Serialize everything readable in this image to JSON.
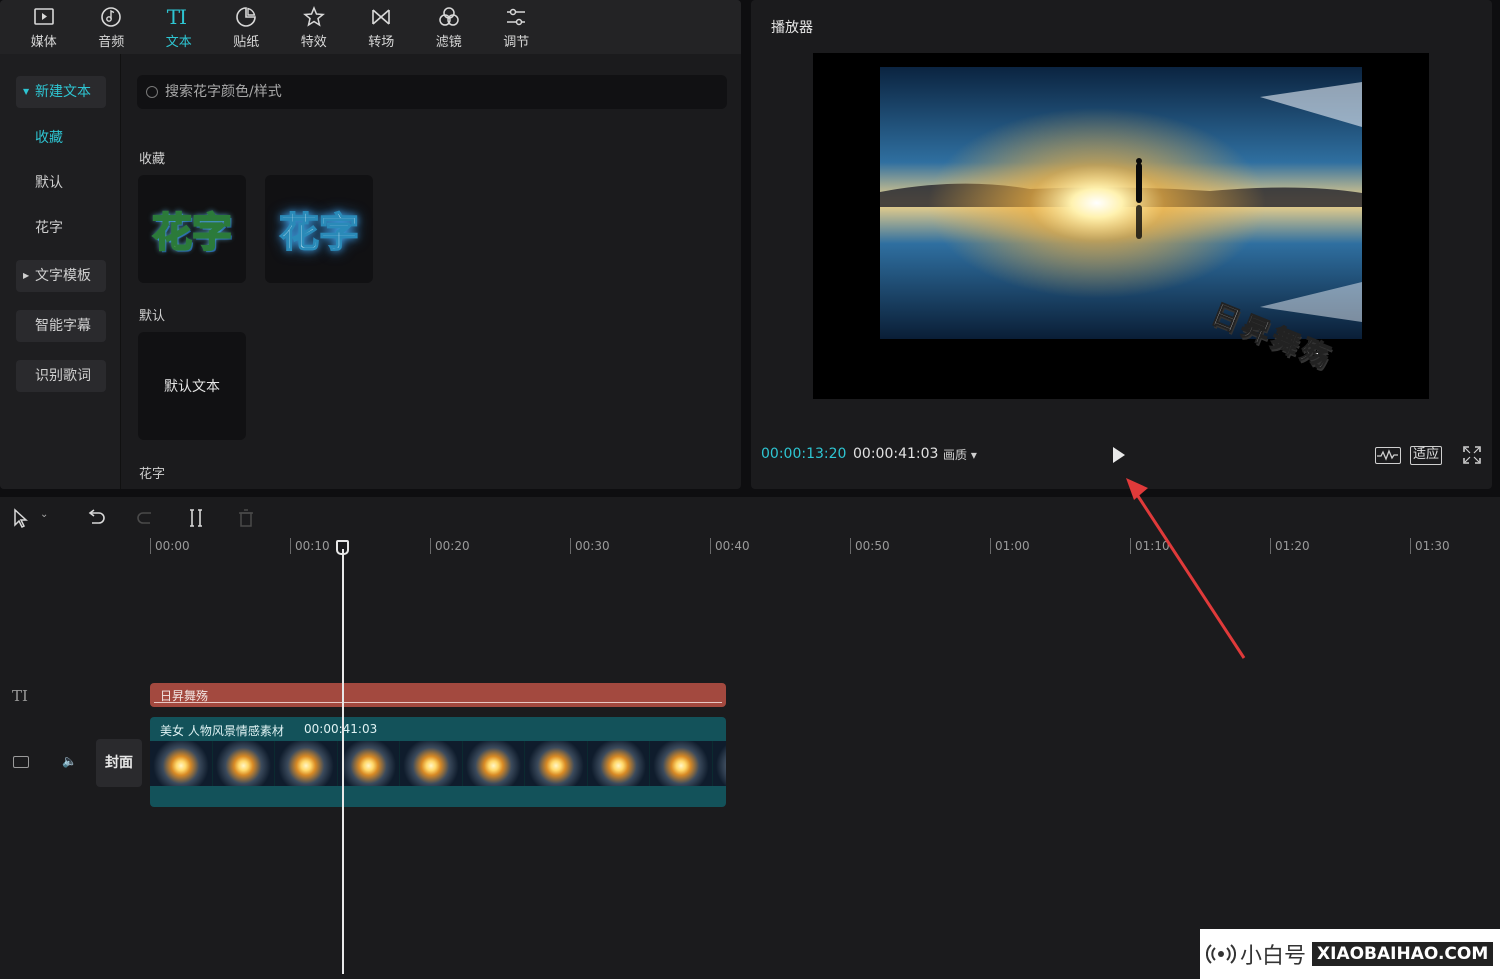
{
  "toolbar": {
    "items": [
      {
        "label": "媒体",
        "icon": "media-icon"
      },
      {
        "label": "音频",
        "icon": "audio-icon"
      },
      {
        "label": "文本",
        "icon": "text-icon",
        "active": true,
        "glyph": "TI"
      },
      {
        "label": "贴纸",
        "icon": "sticker-icon"
      },
      {
        "label": "特效",
        "icon": "effects-icon"
      },
      {
        "label": "转场",
        "icon": "transition-icon"
      },
      {
        "label": "滤镜",
        "icon": "filter-icon"
      },
      {
        "label": "调节",
        "icon": "adjust-icon"
      }
    ]
  },
  "side_menu": {
    "items": [
      {
        "label": "新建文本",
        "active": true,
        "boxed": true,
        "expandable": true
      },
      {
        "label": "收藏",
        "active": true
      },
      {
        "label": "默认"
      },
      {
        "label": "花字"
      },
      {
        "label": "文字模板",
        "boxed": true,
        "expandable": true
      },
      {
        "label": "智能字幕",
        "boxed": true
      },
      {
        "label": "识别歌词",
        "boxed": true
      }
    ]
  },
  "text_panel": {
    "search_placeholder": "搜索花字颜色/样式",
    "sections": {
      "favorites": "收藏",
      "default": "默认",
      "huazi": "花字"
    },
    "favorite_tiles": [
      "花字",
      "花字"
    ],
    "default_tile": "默认文本"
  },
  "player": {
    "title": "播放器",
    "caption_text": "日昇舞殇",
    "time_current": "00:00:13:20",
    "time_total": "00:00:41:03",
    "quality_label": "画质",
    "fit_label": "适应"
  },
  "timeline": {
    "ruler": [
      "00:00",
      "00:10",
      "00:20",
      "00:30",
      "00:40",
      "00:50",
      "01:00",
      "01:10",
      "01:20",
      "01:30"
    ],
    "text_clip_label": "日昇舞殇",
    "video_clip_label": "美女 人物风景情感素材",
    "video_clip_duration": "00:00:41:03",
    "cover_label": "封面",
    "text_track_glyph": "TI"
  },
  "watermark": {
    "cn": "小白号",
    "en": "XIAOBAIHAO.COM"
  },
  "colors": {
    "accent": "#2ec5d2",
    "text_clip": "#a3493f",
    "video_clip": "#13525a",
    "arrow": "#e03a3a"
  }
}
